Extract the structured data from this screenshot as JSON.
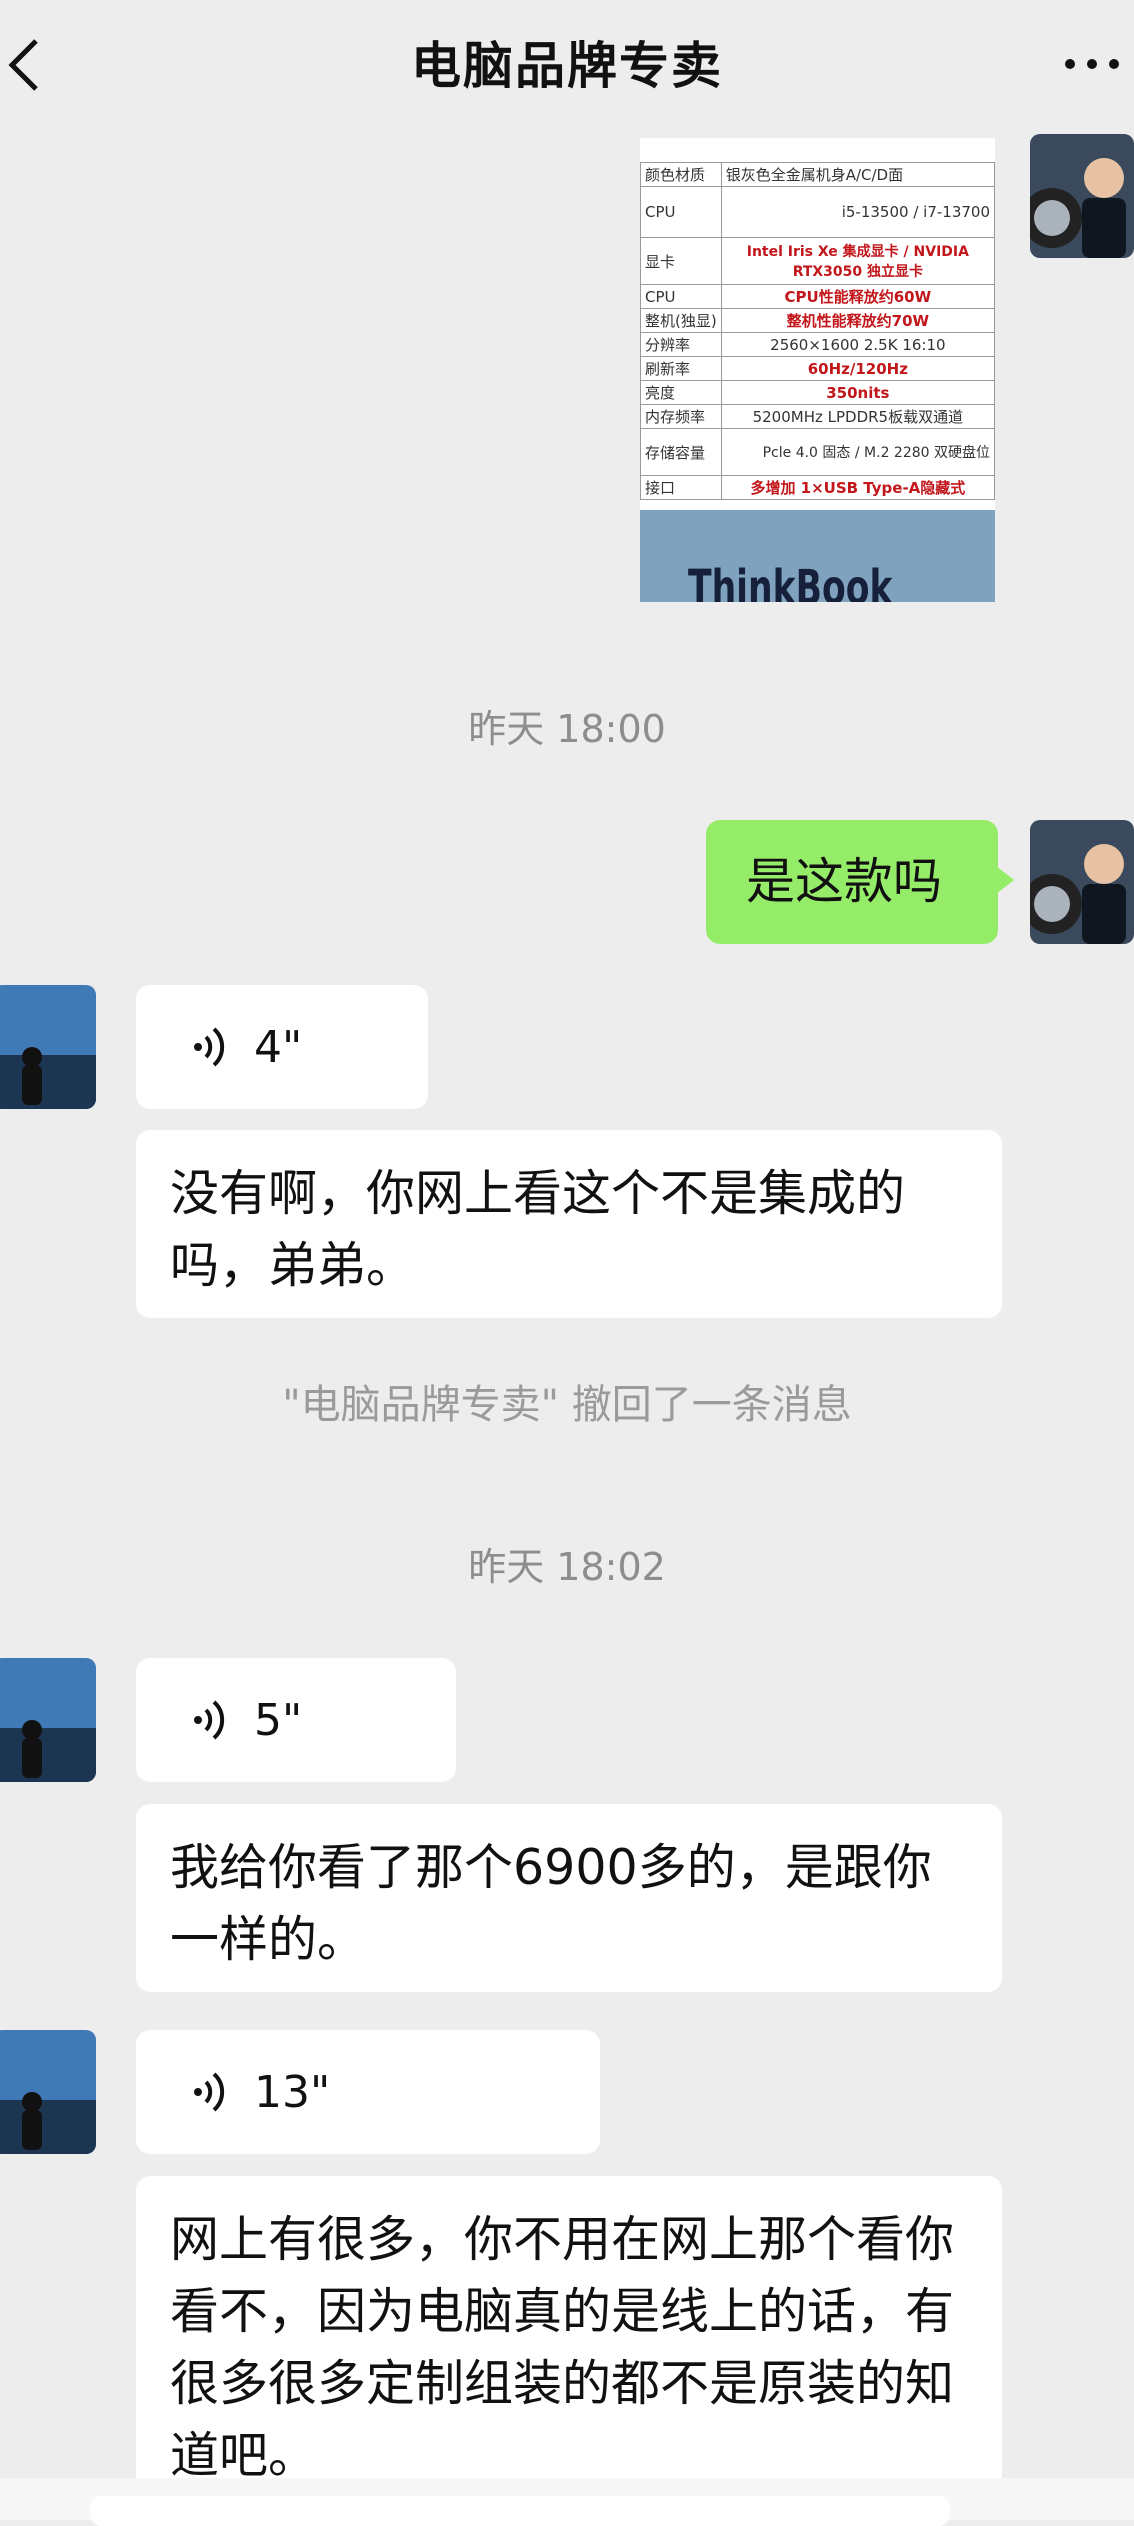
{
  "header": {
    "title": "电脑品牌专卖",
    "back_icon": "chevron-left-icon",
    "more_icon": "ellipsis-icon"
  },
  "spec_sheet": {
    "rows": [
      {
        "label": "颜色材质",
        "value": "银灰色全金属机身A/C/D面"
      },
      {
        "label": "CPU",
        "value": "i5-13500 / i7-13700"
      },
      {
        "label": "显卡",
        "value": "Intel Iris Xe 集成显卡 / NVIDIA RTX3050 独立显卡"
      },
      {
        "label": "CPU",
        "value": "CPU性能释放约60W"
      },
      {
        "label": "整机(独显)",
        "value": "整机性能释放约70W"
      },
      {
        "label": "分辨率",
        "value": "2560×1600 2.5K 16:10"
      },
      {
        "label": "刷新率",
        "value": "60Hz/120Hz"
      },
      {
        "label": "亮度",
        "value": "350nits"
      },
      {
        "label": "内存频率",
        "value": "5200MHz LPDDR5板载双通道"
      },
      {
        "label": "存储容量",
        "value": "Pcle 4.0 固态 / M.2 2280 双硬盘位"
      },
      {
        "label": "接口",
        "value": "多增加 1×USB Type-A隐藏式"
      }
    ],
    "brand": "ThinkBook"
  },
  "timestamps": {
    "t1": "昨天 18:00",
    "t2": "昨天 18:02"
  },
  "messages": {
    "sent_1": "是这款吗",
    "voice_1": "4\"",
    "text_1": "没有啊，你网上看这个不是集成的吗，弟弟。",
    "recall_notice": "\"电脑品牌专卖\" 撤回了一条消息",
    "voice_2": "5\"",
    "text_2": "我给你看了那个6900多的，是跟你一样的。",
    "voice_3": "13\"",
    "text_3": "网上有很多，你不用在网上那个看你看不，因为电脑真的是线上的话，有很多很多定制组装的都不是原装的知道吧。"
  },
  "colors": {
    "background": "#ededed",
    "sent_bubble": "#95ec69",
    "received_bubble": "#ffffff",
    "timestamp": "#8d8d8d"
  }
}
